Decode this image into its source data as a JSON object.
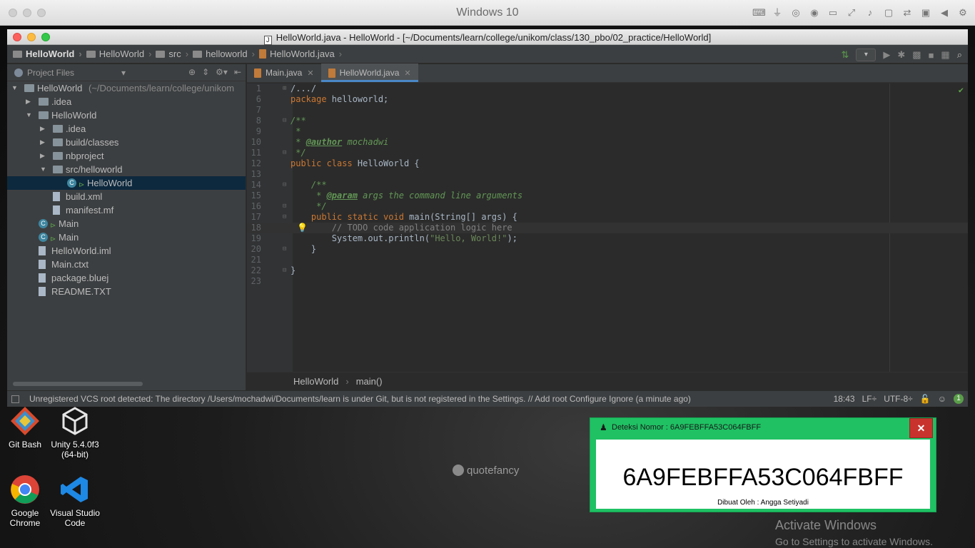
{
  "vm": {
    "title": "Windows 10"
  },
  "ide": {
    "window_title": "HelloWorld.java - HelloWorld - [~/Documents/learn/college/unikom/class/130_pbo/02_practice/HelloWorld]",
    "breadcrumbs": [
      "HelloWorld",
      "HelloWorld",
      "src",
      "helloworld",
      "HelloWorld.java"
    ],
    "project_pane": {
      "title": "Project Files",
      "tree": [
        {
          "label": "HelloWorld",
          "suffix": "(~/Documents/learn/college/unikom",
          "type": "folder",
          "depth": 0,
          "expanded": true
        },
        {
          "label": ".idea",
          "type": "folder",
          "depth": 1,
          "expanded": false
        },
        {
          "label": "HelloWorld",
          "type": "folder",
          "depth": 1,
          "expanded": true
        },
        {
          "label": ".idea",
          "type": "folder",
          "depth": 2,
          "expanded": false
        },
        {
          "label": "build/classes",
          "type": "folder",
          "depth": 2,
          "expanded": false
        },
        {
          "label": "nbproject",
          "type": "folder",
          "depth": 2,
          "expanded": false
        },
        {
          "label": "src/helloworld",
          "type": "folder",
          "depth": 2,
          "expanded": true
        },
        {
          "label": "HelloWorld",
          "type": "class",
          "depth": 3,
          "selected": true
        },
        {
          "label": "build.xml",
          "type": "file",
          "depth": 2
        },
        {
          "label": "manifest.mf",
          "type": "file",
          "depth": 2
        },
        {
          "label": "Main",
          "type": "class",
          "depth": 1
        },
        {
          "label": "Main",
          "type": "class",
          "depth": 1
        },
        {
          "label": "HelloWorld.iml",
          "type": "file",
          "depth": 1
        },
        {
          "label": "Main.ctxt",
          "type": "file",
          "depth": 1
        },
        {
          "label": "package.bluej",
          "type": "file",
          "depth": 1
        },
        {
          "label": "README.TXT",
          "type": "file",
          "depth": 1
        }
      ]
    },
    "tabs": [
      {
        "label": "Main.java",
        "active": false
      },
      {
        "label": "HelloWorld.java",
        "active": true
      }
    ],
    "code_lines": [
      {
        "n": "1",
        "html": "/.../"
      },
      {
        "n": "6",
        "html": "<span class='kw'>package</span> helloworld;"
      },
      {
        "n": "7",
        "html": ""
      },
      {
        "n": "8",
        "html": "<span class='cmt'>/**</span>"
      },
      {
        "n": "9",
        "html": "<span class='cmt'> *</span>"
      },
      {
        "n": "10",
        "html": "<span class='cmt'> * </span><span class='tag'>@author</span><span class='cmt'> mochadwi</span>"
      },
      {
        "n": "11",
        "html": "<span class='cmt'> */</span>"
      },
      {
        "n": "12",
        "html": "<span class='kw'>public class</span> HelloWorld {"
      },
      {
        "n": "13",
        "html": ""
      },
      {
        "n": "14",
        "html": "    <span class='cmt'>/**</span>"
      },
      {
        "n": "15",
        "html": "<span class='cmt'>     * </span><span class='tag'>@param</span><span class='cmt'> args the command line arguments</span>"
      },
      {
        "n": "16",
        "html": "<span class='cmt'>     */</span>"
      },
      {
        "n": "17",
        "html": "    <span class='kw'>public static void</span> main(String[] args) {"
      },
      {
        "n": "18",
        "html": "        <span class='lcmt'>// TODO code application logic here</span>"
      },
      {
        "n": "19",
        "html": "        System.<span style='color:#a9b7c6'>out</span>.println(<span class='str'>\"Hello, World!\"</span>);"
      },
      {
        "n": "20",
        "html": "    }"
      },
      {
        "n": "21",
        "html": ""
      },
      {
        "n": "22",
        "html": "}"
      },
      {
        "n": "23",
        "html": ""
      }
    ],
    "editor_breadcrumbs": [
      "HelloWorld",
      "main()"
    ],
    "status": {
      "message": "Unregistered VCS root detected: The directory /Users/mochadwi/Documents/learn is under Git, but is not registered in the Settings. // Add root  Configure  Ignore (a minute ago)",
      "time": "18:43",
      "line_sep": "LF÷",
      "encoding": "UTF-8÷",
      "event_count": "1"
    }
  },
  "desktop": {
    "icons": [
      {
        "label": "Git Bash"
      },
      {
        "label": "Unity 5.4.0f3 (64-bit)"
      },
      {
        "label": "Google Chrome"
      },
      {
        "label": "Visual Studio Code"
      }
    ],
    "quotefancy": "quotefancy",
    "activate_line1": "Activate Windows",
    "activate_line2": "Go to Settings to activate Windows."
  },
  "popup": {
    "title": "Deteksi Nomor : 6A9FEBFFA53C064FBFF",
    "number": "6A9FEBFFA53C064FBFF",
    "credit": "Dibuat Oleh : Angga Setiyadi",
    "close": "✕"
  }
}
